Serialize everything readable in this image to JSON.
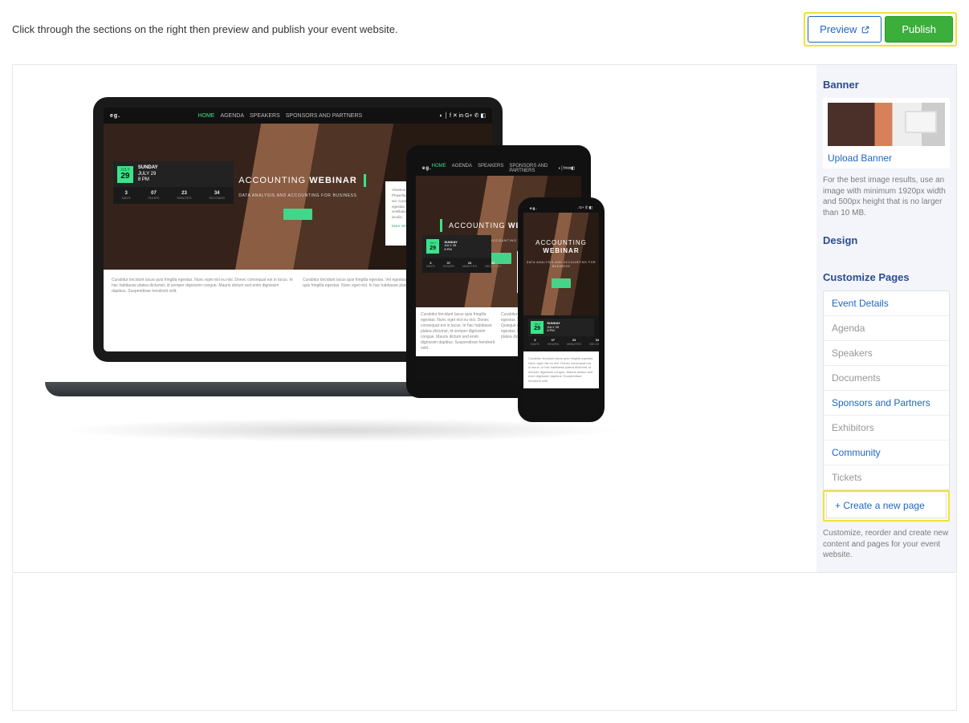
{
  "instruction": "Click through the sections on the right then preview and publish your event website.",
  "actions": {
    "preview": "Preview",
    "publish": "Publish"
  },
  "sidebar": {
    "banner_head": "Banner",
    "upload_link": "Upload Banner",
    "banner_hint": "For the best image results, use an image with minimum 1920px width and 500px height that is no larger than 10 MB.",
    "design_head": "Design",
    "customize_head": "Customize Pages",
    "pages": [
      {
        "label": "Event Details",
        "active": true
      },
      {
        "label": "Agenda",
        "active": false
      },
      {
        "label": "Speakers",
        "active": false
      },
      {
        "label": "Documents",
        "active": false
      },
      {
        "label": "Sponsors and Partners",
        "active": true
      },
      {
        "label": "Exhibitors",
        "active": false
      },
      {
        "label": "Community",
        "active": true
      },
      {
        "label": "Tickets",
        "active": false
      }
    ],
    "create_page": "+ Create a new page",
    "customize_hint": "Customize, reorder and create new content and pages for your event website."
  },
  "mock": {
    "logo": "eg.",
    "nav": [
      "HOME",
      "AGENDA",
      "SPEAKERS",
      "SPONSORS AND PARTNERS"
    ],
    "title_thin": "ACCOUNTING",
    "title_bold": "WEBINAR",
    "subtitle": "DATA ANALYSIS AND ACCOUNTING FOR BUSINESS",
    "date_month": "JULY",
    "date_daynum": "29",
    "date_dow": "SUNDAY",
    "date_full": "JULY 29",
    "date_time": "8 PM",
    "count": [
      {
        "n": "3",
        "u": "DAYS"
      },
      {
        "n": "07",
        "u": "HOURS"
      },
      {
        "n": "23",
        "u": "MINUTES"
      },
      {
        "n": "34",
        "u": "SECONDS"
      }
    ],
    "lorem_a": "Vivamus rutrum rutrum neque eu accumsan. Phasellus turpis ante, bibendum vel aliquam sed vel. Curabitur tincidunt lacus quis fringilla egestas. Nam egestas libero, eu ornare urna vestibulum ut. Nunc ullamcorper est ut fringilla iaculis.",
    "lorem_more": "More Information...",
    "lorem_b": "Curabitur tincidunt lacus quis fringilla egestas. Nunc eget nisl eu nisi. Donec consequat est in lacus. In hac habitasse platea dictumst, id semper dignissim congue. Mauris dictum sed enim dignissim dapibus. Suspendisse hendrerit velit.",
    "lorem_c": "Curabitur tincidunt lacus quis fringilla egestas. Vel egestas a at fringilla aculis. Quisque rutrum ipsum quis fringilla egestas. Nunc eget nisl. In hac habitasse platea dictumst aliquam erat."
  }
}
